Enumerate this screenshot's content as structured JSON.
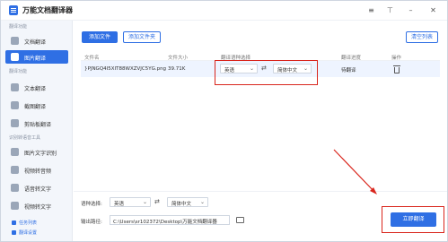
{
  "window": {
    "title": "万能文档翻译器"
  },
  "sidebar": {
    "sections": [
      {
        "title": "翻译功能",
        "items": [
          {
            "label": "文档翻译"
          },
          {
            "label": "图片翻译"
          }
        ]
      },
      {
        "title": "翻译功能",
        "items": [
          {
            "label": "文本翻译"
          },
          {
            "label": "截图翻译"
          },
          {
            "label": "剪贴板翻译"
          }
        ]
      },
      {
        "title": "识别转语音工具",
        "items": [
          {
            "label": "图片文字识别"
          },
          {
            "label": "视频转音频"
          },
          {
            "label": "语音转文字"
          },
          {
            "label": "视频转文字"
          }
        ]
      }
    ],
    "bottom_links": [
      "任务列表",
      "翻译设置"
    ]
  },
  "toolbar": {
    "add_file": "添加文件",
    "add_folder": "添加文件夹",
    "clear_list": "清空列表"
  },
  "table": {
    "headers": [
      "文件名",
      "文件大小",
      "翻译语种选择",
      "翻译进度",
      "操作"
    ],
    "rows": [
      {
        "filename": "}PJNGQ4I5XIT88WXZVJC5YG.png",
        "size": "39.71K",
        "source_lang": "英语",
        "target_lang": "简体中文",
        "progress": "待翻译"
      }
    ]
  },
  "footer": {
    "lang_label": "语种选择:",
    "source_lang": "英语",
    "target_lang": "简体中文",
    "output_label": "输出路径:",
    "output_path": "C:\\Users\\sr102372\\Desktop\\万能文档翻译器",
    "translate_button": "立即翻译"
  },
  "colors": {
    "accent": "#2f6fe4",
    "annotation": "#d9251c"
  }
}
